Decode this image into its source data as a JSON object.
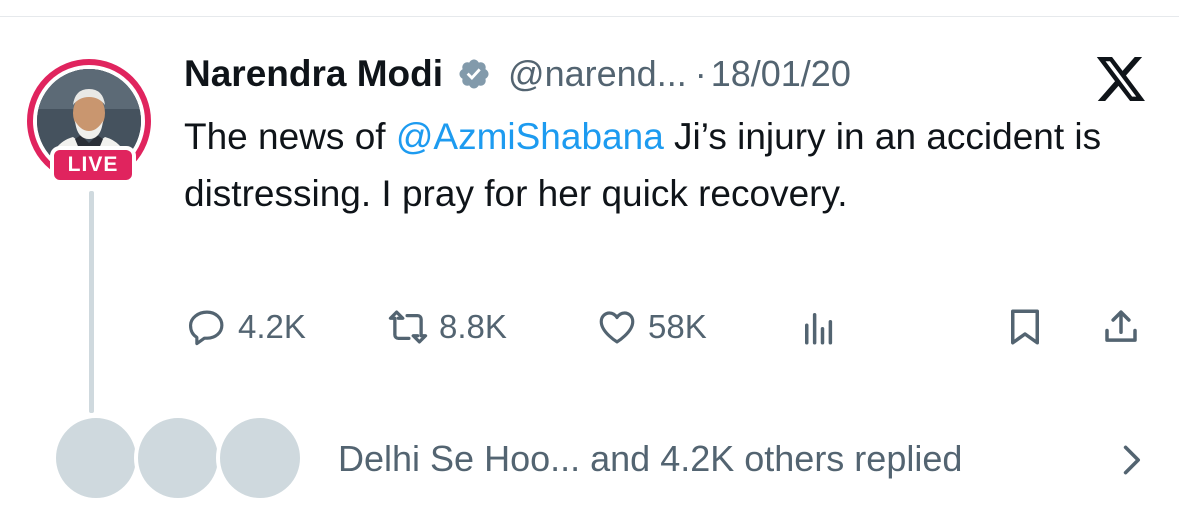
{
  "tweet": {
    "author_name": "Narendra Modi",
    "handle": "@narend...",
    "separator": "·",
    "date": "18/01/20",
    "live_badge": "LIVE",
    "text_before": "The news of ",
    "mention": "@AzmiShabana",
    "text_after": " Ji’s injury in an accident is distressing. I pray for her quick recovery."
  },
  "actions": {
    "replies": "4.2K",
    "reposts": "8.8K",
    "likes": "58K"
  },
  "replies_summary": {
    "text": "Delhi Se Hoo... and 4.2K others replied"
  },
  "colors": {
    "accent": "#1d9bf0",
    "live": "#e0245e",
    "muted": "#536471",
    "placeholder": "#cfd9de"
  },
  "icons": [
    "verified-badge-icon",
    "x-logo-icon",
    "reply-icon",
    "repost-icon",
    "like-icon",
    "views-icon",
    "bookmark-icon",
    "share-icon",
    "chevron-right-icon"
  ]
}
